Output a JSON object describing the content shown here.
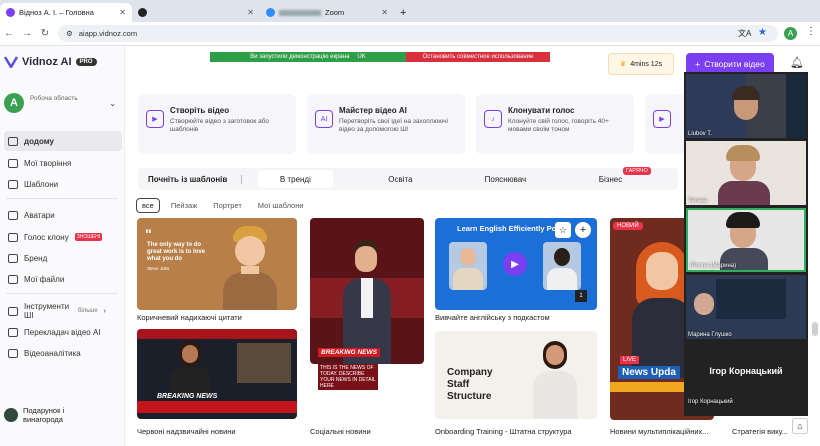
{
  "tabs": [
    {
      "label": "Відноз А. І. – Головна",
      "active": true
    },
    {
      "label": "",
      "active": false
    },
    {
      "label": "Zoom",
      "active": false
    }
  ],
  "address": {
    "url": "aiapp.vidnoz.com"
  },
  "sidebar": {
    "logo": "Vidnoz AI",
    "pro": "PRO",
    "workspace_initial": "A",
    "workspace_label": "Робоча область",
    "items": [
      {
        "label": "додому"
      },
      {
        "label": "Мої творіння"
      },
      {
        "label": "Шаблони"
      },
      {
        "label": "Аватари"
      },
      {
        "label": "Голос клону",
        "badge": "ЗНОШЕНІ"
      },
      {
        "label": "Бренд"
      },
      {
        "label": "Мої файли"
      },
      {
        "label": "Інструменти ШІ",
        "suffix": "більше"
      },
      {
        "label": "Перекладач відео AI"
      },
      {
        "label": "Відеоаналітика"
      }
    ],
    "gift": "Подарунок і винагорода"
  },
  "banner": {
    "left": "Ви запустили демонстрацію екрана",
    "mid": "UK",
    "right": "Остановить совместное использование"
  },
  "header": {
    "timer": "4mins 12s",
    "create": "Створити відео"
  },
  "features": [
    {
      "title": "Створіть відео",
      "desc": "Створюйте відео з заготовок або шаблонів"
    },
    {
      "title": "Майстер відео AI",
      "desc": "Перетворіть свої ідеї на захоплюючі відео за допомогою ШІ"
    },
    {
      "title": "Клонувати голос",
      "desc": "Клонуйте свій голос, говоріть 40+ мовами своїм тоном"
    }
  ],
  "templates": {
    "title": "Почніть із шаблонів",
    "tabs": [
      "В тренді",
      "Освіта",
      "Пояснювач",
      "Бізнес"
    ],
    "hot": "ГАРЯЧО",
    "filters": [
      "все",
      "Пейзаж",
      "Портрет",
      "Мої шаблони"
    ],
    "cards": [
      {
        "label": "Коричневий надихаючі цитати",
        "quote": "The only way to do great work is to love what you do",
        "author": "Steve Jobs"
      },
      {
        "label": "",
        "text": ""
      },
      {
        "label": "Вивчайте англійську з подкастом",
        "title": "Learn English Efficiently Po"
      },
      {
        "label": "",
        "tag": "НОВИЙ"
      },
      {
        "label": "Червоні надзвичайні новини",
        "text": "BREAKING NEWS"
      },
      {
        "label": "Соціальні новини",
        "text": "BREAKING NEWS",
        "sub": "THIS IS THE NEWS OF TODAY. DESCRIBE YOUR NEWS IN DETAIL HERE"
      },
      {
        "label": "Onboarding Training - Штатна структура",
        "title": "Company Staff Structure"
      },
      {
        "label": "Новини мультиплікаційних...",
        "text": "News Upda",
        "live": "LIVE"
      }
    ],
    "extra_label": "Стратегія вику..."
  },
  "video_panel": {
    "tiles": [
      {
        "name": "Liubov T."
      },
      {
        "name": "Тетяна"
      },
      {
        "name": "iPhone (Марина)"
      },
      {
        "name": "Марина Глушко"
      },
      {
        "name": "Ігор Корнацький",
        "big": "Ігор Корнацький"
      }
    ]
  }
}
